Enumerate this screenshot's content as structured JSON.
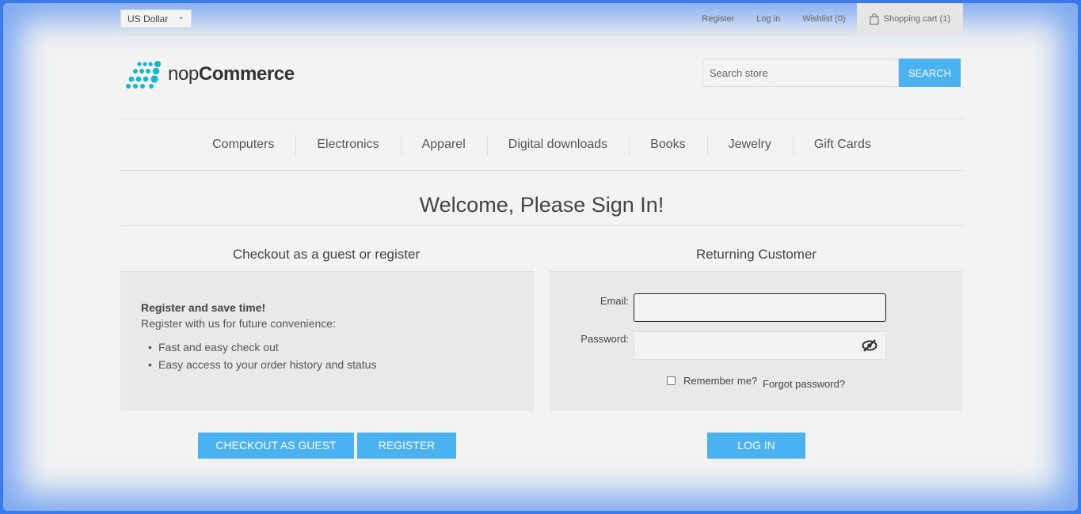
{
  "header": {
    "currency": "US Dollar",
    "links": {
      "register": "Register",
      "login": "Log in",
      "wishlist": "Wishlist (0)",
      "cart": "Shopping cart (1)"
    }
  },
  "logo": {
    "prefix": "nop",
    "brand": "Commerce"
  },
  "search": {
    "placeholder": "Search store",
    "button": "SEARCH"
  },
  "menu": [
    "Computers",
    "Electronics",
    "Apparel",
    "Digital downloads",
    "Books",
    "Jewelry",
    "Gift Cards"
  ],
  "page_title": "Welcome, Please Sign In!",
  "guest": {
    "title": "Checkout as a guest or register",
    "heading": "Register and save time!",
    "text": "Register with us for future convenience:",
    "bullets": [
      "Fast and easy check out",
      "Easy access to your order history and status"
    ],
    "checkout_button": "CHECKOUT AS GUEST",
    "register_button": "REGISTER"
  },
  "returning": {
    "title": "Returning Customer",
    "email_label": "Email:",
    "password_label": "Password:",
    "remember_label": "Remember me?",
    "forgot_label": "Forgot password?",
    "login_button": "LOG IN"
  },
  "colors": {
    "accent": "#4ab2f1",
    "logo_dots": "#19b7c9"
  },
  "icons": {
    "cart": "shopping-bag-icon",
    "password_toggle": "eye-slash-icon",
    "currency": "chevron-down-icon"
  }
}
